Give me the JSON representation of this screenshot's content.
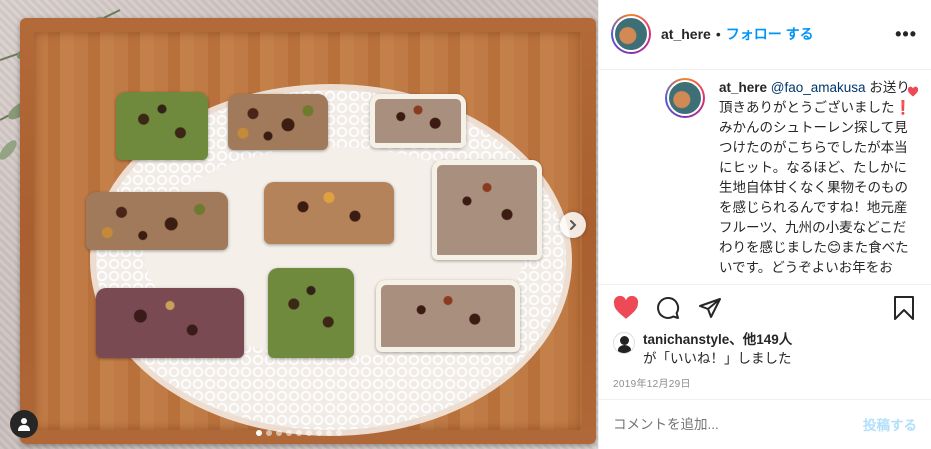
{
  "post": {
    "username": "at_here",
    "separator": "•",
    "follow_label": "フォロー する",
    "more_label": "•••",
    "carousel": {
      "slide_count": 9,
      "active_index": 0
    }
  },
  "comment": {
    "username": "at_here",
    "mention": "@fao_amakusa",
    "text": " お送り頂きありがとうございました❗ みかんのシュトーレン探して見つけたのがこちらでしたが本当にヒット。なるほど、たしかに生地自体甘くなく果物そのものを感じられるんですね！地元産フルーツ、九州の小麦などこだわりを感じました😊また食べたいです。どうぞよいお年をお"
  },
  "likes": {
    "user": "tanichanstyle",
    "others": "、他149人",
    "suffix": "が「いいね！」しました"
  },
  "date": "2019年12月29日",
  "add_comment": {
    "placeholder": "コメントを追加...",
    "post_label": "投稿する"
  },
  "colors": {
    "like_red": "#ed4956",
    "follow_blue": "#0095f6",
    "post_disabled": "#b2dffc"
  }
}
